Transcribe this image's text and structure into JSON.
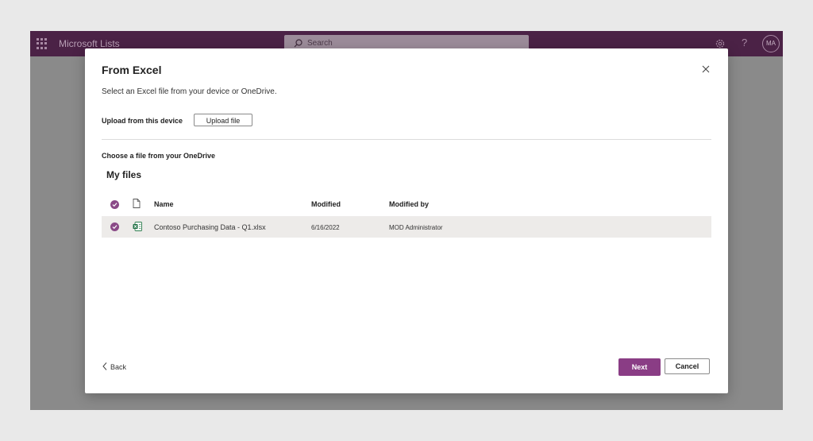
{
  "app": {
    "title": "Microsoft Lists",
    "search_placeholder": "Search",
    "avatar_initials": "MA",
    "help_glyph": "?",
    "brand_color": "#4b2246"
  },
  "dialog": {
    "title": "From Excel",
    "subtitle": "Select an Excel file from your device or OneDrive.",
    "upload_label": "Upload from this device",
    "upload_button": "Upload file",
    "onedrive_label": "Choose a file from your OneDrive",
    "folder_title": "My files",
    "columns": [
      "Name",
      "Modified",
      "Modified by"
    ],
    "files": [
      {
        "name": "Contoso Purchasing Data - Q1.xlsx",
        "modified": "6/16/2022",
        "modified_by": "MOD Administrator",
        "selected": true,
        "icon": "excel-file-icon"
      }
    ],
    "back_label": "Back",
    "next_label": "Next",
    "cancel_label": "Cancel",
    "accent_color": "#8a3d85"
  }
}
